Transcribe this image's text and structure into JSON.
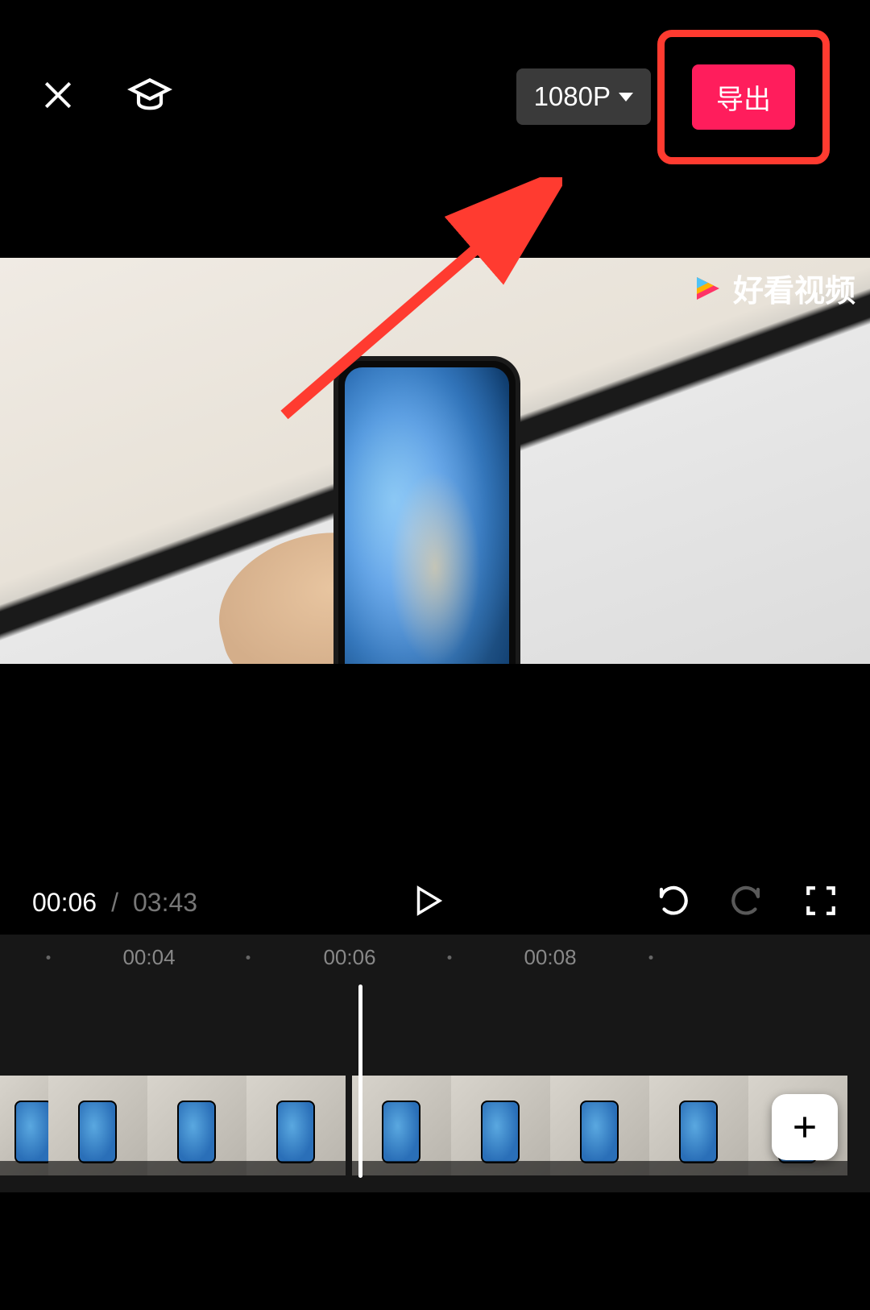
{
  "toolbar": {
    "resolution_label": "1080P",
    "export_label": "导出"
  },
  "preview": {
    "watermark_text": "好看视频"
  },
  "playback": {
    "current_time": "00:06",
    "separator": "/",
    "total_time": "03:43"
  },
  "timeline": {
    "marks": [
      "00:04",
      "00:06",
      "00:08"
    ]
  },
  "icons": {
    "close": "close-icon",
    "tutorial": "graduation-cap-icon",
    "play": "play-icon",
    "undo": "undo-icon",
    "redo": "redo-icon",
    "fullscreen": "fullscreen-icon",
    "add": "plus-icon"
  }
}
